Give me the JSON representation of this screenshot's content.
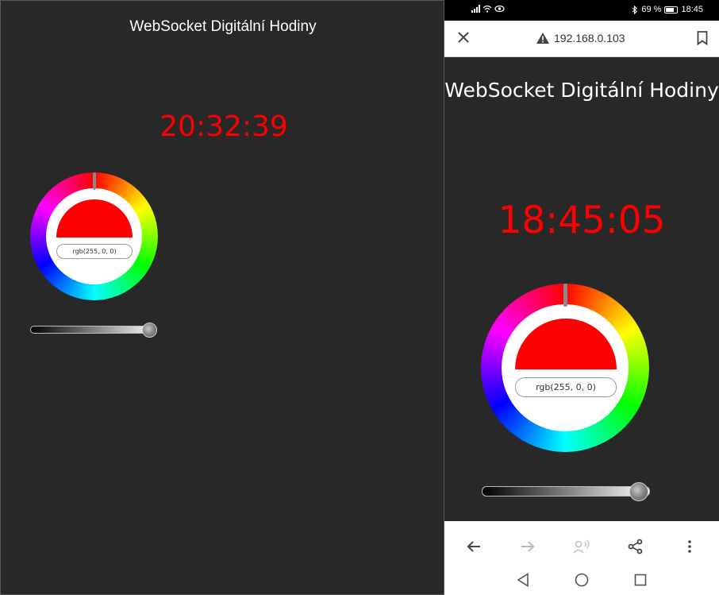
{
  "desktop": {
    "title": "WebSocket Digitální Hodiny",
    "clock": "20:32:39",
    "rgb_value": "rgb(255, 0, 0)"
  },
  "phone": {
    "status": {
      "battery": "69 %",
      "time": "18:45"
    },
    "url": "192.168.0.103",
    "title": "WebSocket Digitální Hodiny",
    "clock": "18:45:05",
    "rgb_value": "rgb(255, 0, 0)"
  },
  "colors": {
    "background": "#282828",
    "clock": "#ff0000",
    "title": "#ffffff",
    "selected_color": "#ff0000"
  },
  "color_picker": {
    "selected": "rgb(255, 0, 0)",
    "brightness": 1.0
  },
  "icons": {
    "close": "close-icon",
    "warning": "warning-icon",
    "bookmark": "bookmark-icon",
    "back": "arrow-back-icon",
    "forward": "arrow-forward-icon",
    "read_aloud": "read-aloud-icon",
    "share": "share-icon",
    "more": "more-vert-icon",
    "nav_back": "nav-back-icon",
    "nav_home": "nav-home-icon",
    "nav_recents": "nav-recents-icon"
  }
}
